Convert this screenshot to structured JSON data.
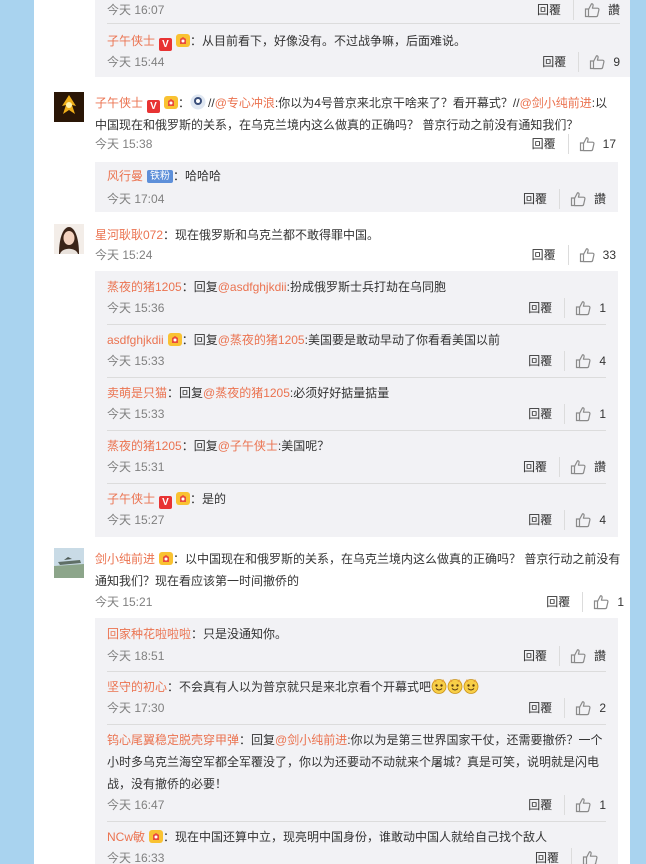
{
  "actions": {
    "reply_label": "回覆",
    "like_label": "讚"
  },
  "top_reply": {
    "time": "今天 16:07",
    "like": "讚"
  },
  "block1": {
    "reply1": {
      "name": "子午侠士",
      "text": "：从目前看下，好像没有。不过战争嘛，后面难说。",
      "time": "今天 15:44",
      "likes": "9"
    }
  },
  "c2": {
    "name": "子午侠士",
    "mention1": "@专心冲浪",
    "text1": ":你以为4号普京来北京干啥来了？看开幕式？//",
    "mention2": "@剑小纯前进",
    "text2": ":以中国现在和俄罗斯的关系，在乌克兰境内这么做真的正确吗？ 普京行动之前没有通知我们？",
    "time": "今天 15:38",
    "likes": "17",
    "replies": [
      {
        "name": "风行曼",
        "badge": "铁粉",
        "text": "：哈哈哈",
        "time": "今天 17:04",
        "likes": "讚"
      }
    ]
  },
  "c3": {
    "name": "星河耿耿072",
    "text": "：现在俄罗斯和乌克兰都不敢得罪中国。",
    "time": "今天 15:24",
    "likes": "33",
    "replies": [
      {
        "name": "蒸夜的猪1205",
        "pre": "：回复",
        "at": "@asdfghjkdii",
        "text": ":扮成俄罗斯士兵打劫在乌同胞",
        "time": "今天 15:36",
        "likes": "1"
      },
      {
        "name": "asdfghjkdii",
        "pre": "：回复",
        "at": "@蒸夜的猪1205",
        "text": ":美国要是敢动早动了你看看美国以前",
        "time": "今天 15:33",
        "likes": "4"
      },
      {
        "name": "卖萌是只猫",
        "pre": "：回复",
        "at": "@蒸夜的猪1205",
        "text": ":必须好好掂量掂量",
        "time": "今天 15:33",
        "likes": "1"
      },
      {
        "name": "蒸夜的猪1205",
        "pre": "：回复",
        "at": "@子午侠士",
        "text": ":美国呢？",
        "time": "今天 15:31",
        "likes": "讚"
      },
      {
        "name": "子午侠士",
        "text": "：是的",
        "time": "今天 15:27",
        "likes": "4"
      }
    ]
  },
  "c4": {
    "name": "剑小纯前进",
    "text": "：以中国现在和俄罗斯的关系，在乌克兰境内这么做真的正确吗？ 普京行动之前没有通知我们？现在看应该第一时间撤侨的",
    "time": "今天 15:21",
    "likes": "1",
    "replies": [
      {
        "name": "回家种花啦啦啦",
        "text": "：只是没通知你。",
        "time": "今天 18:51",
        "likes": "讚"
      },
      {
        "name": "坚守的初心",
        "text": "：不会真有人以为普京就只是来北京看个开幕式吧",
        "time": "今天 17:30",
        "likes": "2"
      },
      {
        "name": "钨心尾翼稳定脱壳穿甲弹",
        "pre": "：回复",
        "at": "@剑小纯前进",
        "text": ":你以为是第三世界国家干仗，还需要撤侨？一个小时多乌克兰海空军都全军覆没了，你以为还要动不动就来个屠城？真是可笑，说明就是闪电战，没有撤侨的必要！",
        "time": "今天 16:47",
        "likes": "1"
      },
      {
        "name": "NCw敏",
        "text": "：现在中国还算中立，现亮明中国身份，谁敢动中国人就给自己找个敌人",
        "time": "今天 16:33",
        "likes": ""
      }
    ]
  }
}
